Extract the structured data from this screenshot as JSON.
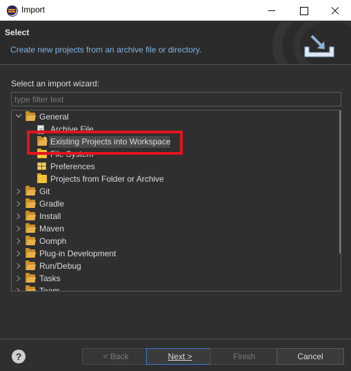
{
  "window": {
    "title": "Import"
  },
  "header": {
    "title": "Select",
    "description": "Create new projects from an archive file or directory."
  },
  "wizard": {
    "label": "Select an import wizard:",
    "filter_placeholder": "type filter text",
    "tree": [
      {
        "label": "General",
        "level": 0,
        "expanded": true,
        "icon": "folder-open-icon"
      },
      {
        "label": "Archive File",
        "level": 1,
        "icon": "archive-file-icon"
      },
      {
        "label": "Existing Projects into Workspace",
        "level": 1,
        "icon": "existing-projects-icon",
        "selected": true
      },
      {
        "label": "File System",
        "level": 1,
        "icon": "folder-icon"
      },
      {
        "label": "Preferences",
        "level": 1,
        "icon": "preferences-icon"
      },
      {
        "label": "Projects from Folder or Archive",
        "level": 1,
        "icon": "folder-icon"
      },
      {
        "label": "Git",
        "level": 0,
        "expanded": false,
        "icon": "folder-open-icon"
      },
      {
        "label": "Gradle",
        "level": 0,
        "expanded": false,
        "icon": "folder-open-icon"
      },
      {
        "label": "Install",
        "level": 0,
        "expanded": false,
        "icon": "folder-open-icon"
      },
      {
        "label": "Maven",
        "level": 0,
        "expanded": false,
        "icon": "folder-open-icon"
      },
      {
        "label": "Oomph",
        "level": 0,
        "expanded": false,
        "icon": "folder-open-icon"
      },
      {
        "label": "Plug-in Development",
        "level": 0,
        "expanded": false,
        "icon": "folder-open-icon"
      },
      {
        "label": "Run/Debug",
        "level": 0,
        "expanded": false,
        "icon": "folder-open-icon"
      },
      {
        "label": "Tasks",
        "level": 0,
        "expanded": false,
        "icon": "folder-open-icon"
      },
      {
        "label": "Team",
        "level": 0,
        "expanded": false,
        "icon": "folder-open-icon"
      }
    ]
  },
  "buttons": {
    "help": "?",
    "back": "< Back",
    "next": "Next >",
    "finish": "Finish",
    "cancel": "Cancel"
  },
  "colors": {
    "highlight_border": "#e3141e",
    "header_description": "#7fb4e4",
    "default_button_border": "#3a7bd5"
  }
}
